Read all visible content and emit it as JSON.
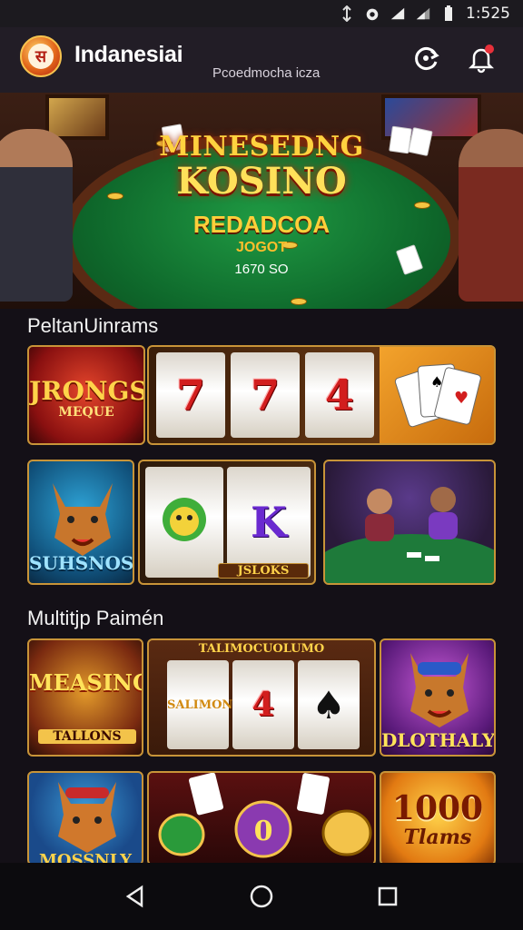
{
  "status_bar": {
    "time": "1:525"
  },
  "header": {
    "title": "Indanesiai",
    "subtitle": "Pcoedmocha icza",
    "logo_glyph": "स",
    "icons": [
      "refresh-icon",
      "bell-icon"
    ]
  },
  "hero": {
    "line1": "MINESEDNG",
    "line2": "KOSINO",
    "line3": "REDADCOA",
    "line4": "JOGOT",
    "line5": "1670 SO"
  },
  "sections": [
    {
      "title": "PeltanUinrams"
    },
    {
      "title": "Multitjp Paimén"
    }
  ],
  "tiles": {
    "jrongs": {
      "title": "JRONGS",
      "subtitle": "MEQUE"
    },
    "reels_a": [
      "7",
      "7",
      "4"
    ],
    "suhsnos": {
      "title": "SUHSNOS"
    },
    "reels_b_letter": "K",
    "reels_b_caption": "JSLOKS",
    "measing": {
      "title": "MEASING",
      "subtitle": "TALLONS"
    },
    "reels_c_header": "TALIMOCUOLUMO",
    "reels_c_word": "SALIMONS",
    "reels_c_sym": "4",
    "dlotnaly": {
      "title": "DLOTHALY"
    },
    "mossnly": {
      "title": "MOSSNLY"
    },
    "tiles_1000": {
      "title": "1000",
      "subtitle": "Tlams"
    }
  },
  "colors": {
    "accent": "#c89438",
    "bg": "#141017",
    "header_bg": "#221d26",
    "gold": "#ffd23f"
  }
}
